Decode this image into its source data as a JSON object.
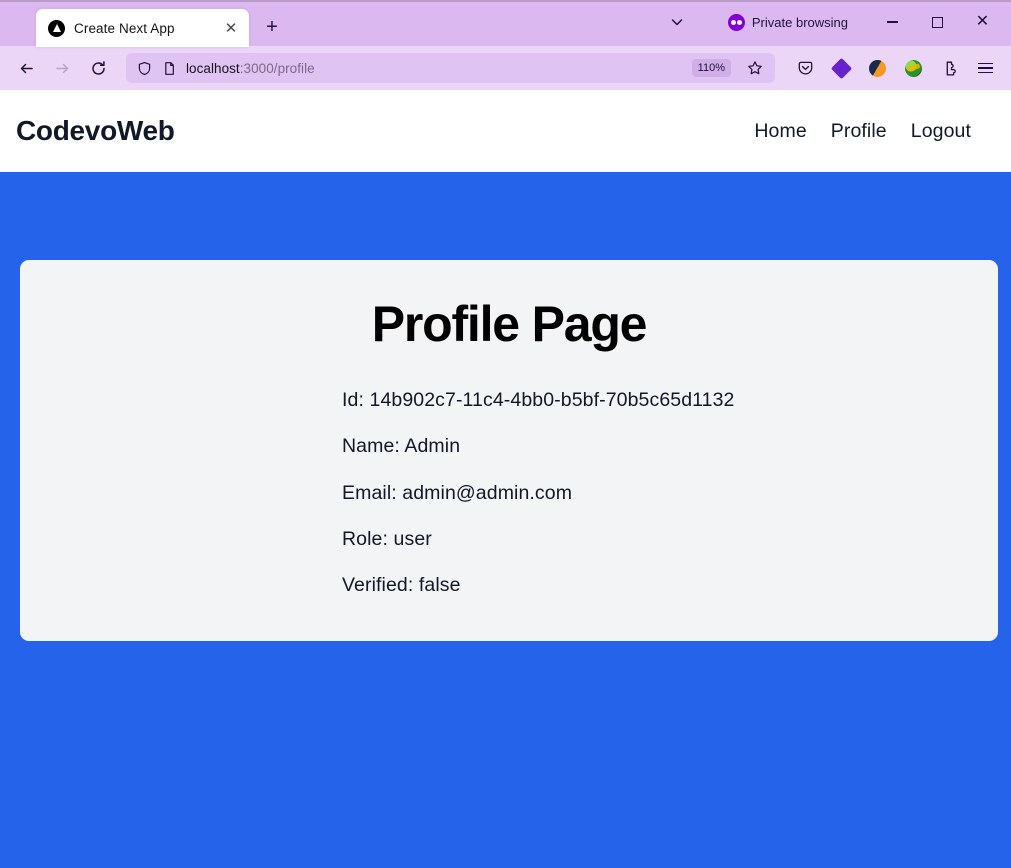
{
  "browser": {
    "tab": {
      "title": "Create Next App",
      "favicon_icon": "nextjs-triangle-icon",
      "close_icon": "close-icon"
    },
    "new_tab_icon": "plus-icon",
    "tab_list_chevron_icon": "chevron-down-icon",
    "private_browsing": {
      "label": "Private browsing",
      "icon": "private-mask-icon",
      "color": "#8000d7"
    },
    "window_controls": {
      "minimize_icon": "minimize-icon",
      "maximize_icon": "maximize-icon",
      "close_icon": "window-close-icon"
    },
    "toolbar": {
      "back_icon": "arrow-left-icon",
      "forward_icon": "arrow-right-icon",
      "reload_icon": "reload-icon",
      "shield_icon": "shield-icon",
      "page_icon": "page-document-icon",
      "url_host": "localhost",
      "url_path": ":3000/profile",
      "zoom_level": "110%",
      "bookmark_icon": "star-icon",
      "extensions": [
        {
          "name": "pocket-icon"
        },
        {
          "name": "purple-diamond-extension-icon"
        },
        {
          "name": "simplify-extension-icon"
        },
        {
          "name": "idm-extension-icon"
        },
        {
          "name": "extensions-puzzle-icon"
        }
      ],
      "app_menu_icon": "hamburger-menu-icon"
    },
    "chrome_colors": {
      "tabstrip_bg": "#dcb8f0",
      "toolbar_bg": "#ecd6f7",
      "urlbar_bg": "#dfc3f2"
    }
  },
  "page": {
    "header": {
      "brand": "CodevoWeb",
      "nav": [
        {
          "label": "Home"
        },
        {
          "label": "Profile"
        },
        {
          "label": "Logout"
        }
      ]
    },
    "hero": {
      "background_color": "#2563eb",
      "card_background": "#f3f4f6",
      "title": "Profile Page",
      "fields": [
        {
          "label": "Id",
          "value": "14b902c7-11c4-4bb0-b5bf-70b5c65d1132",
          "text": "Id: 14b902c7-11c4-4bb0-b5bf-70b5c65d1132"
        },
        {
          "label": "Name",
          "value": "Admin",
          "text": "Name: Admin"
        },
        {
          "label": "Email",
          "value": "admin@admin.com",
          "text": "Email: admin@admin.com"
        },
        {
          "label": "Role",
          "value": "user",
          "text": "Role: user"
        },
        {
          "label": "Verified",
          "value": "false",
          "text": "Verified: false"
        }
      ]
    }
  }
}
